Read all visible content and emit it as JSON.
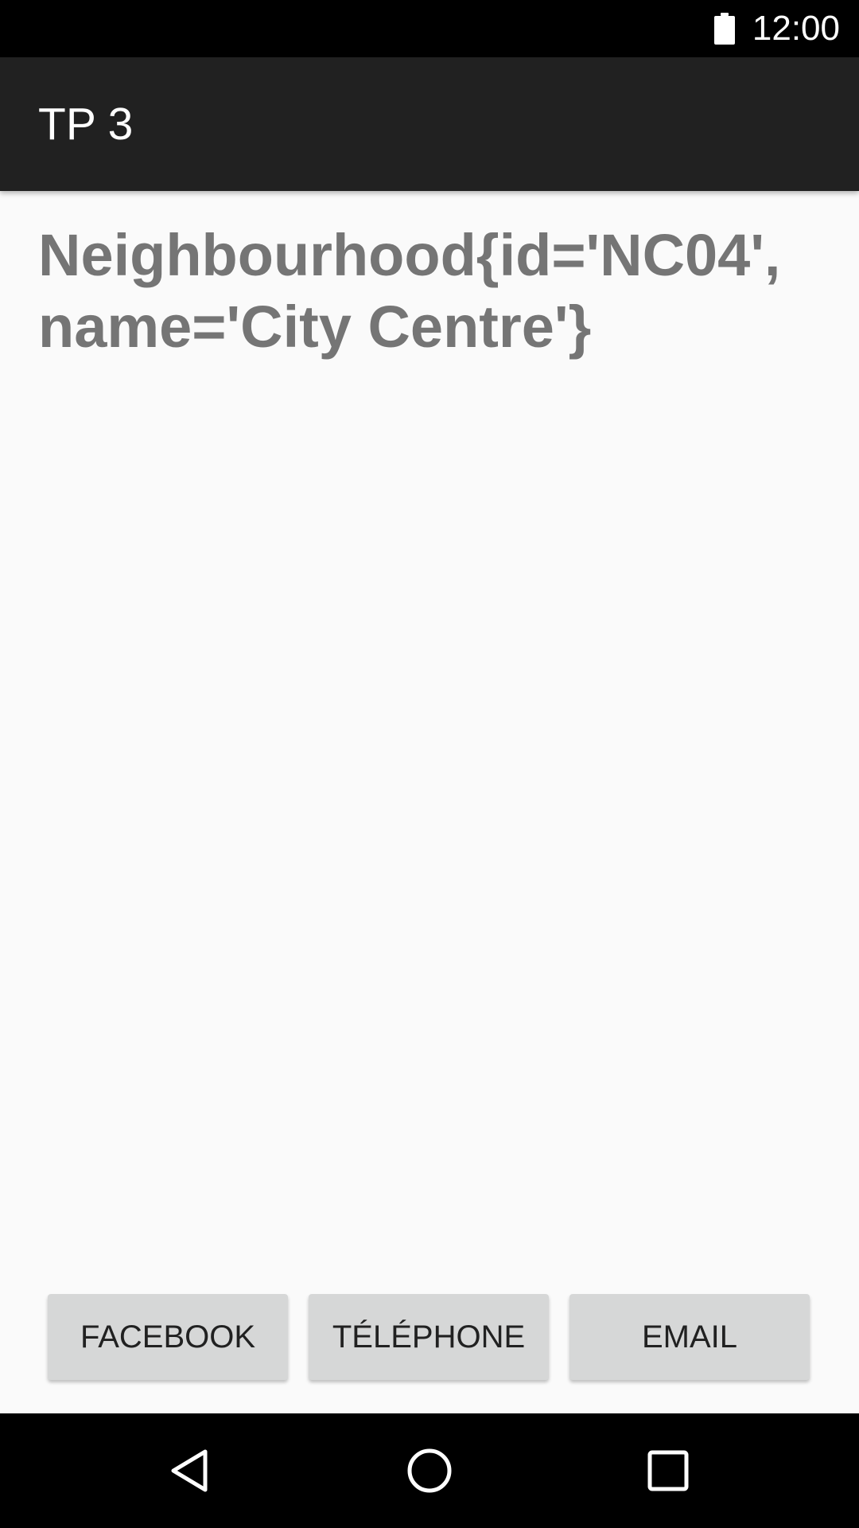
{
  "status_bar": {
    "time": "12:00",
    "icons": [
      "battery-icon"
    ]
  },
  "app_bar": {
    "title": "TP 3"
  },
  "content": {
    "detail_text": "Neighbourhood{id='NC04', name='City Centre'}"
  },
  "buttons": {
    "facebook": "FACEBOOK",
    "telephone": "TÉLÉPHONE",
    "email": "EMAIL"
  },
  "nav_bar": {
    "icons": [
      "back-icon",
      "home-icon",
      "recent-apps-icon"
    ]
  },
  "colors": {
    "app_bar": "#212121",
    "detail_text": "#757575",
    "button_bg": "#d6d7d7"
  }
}
